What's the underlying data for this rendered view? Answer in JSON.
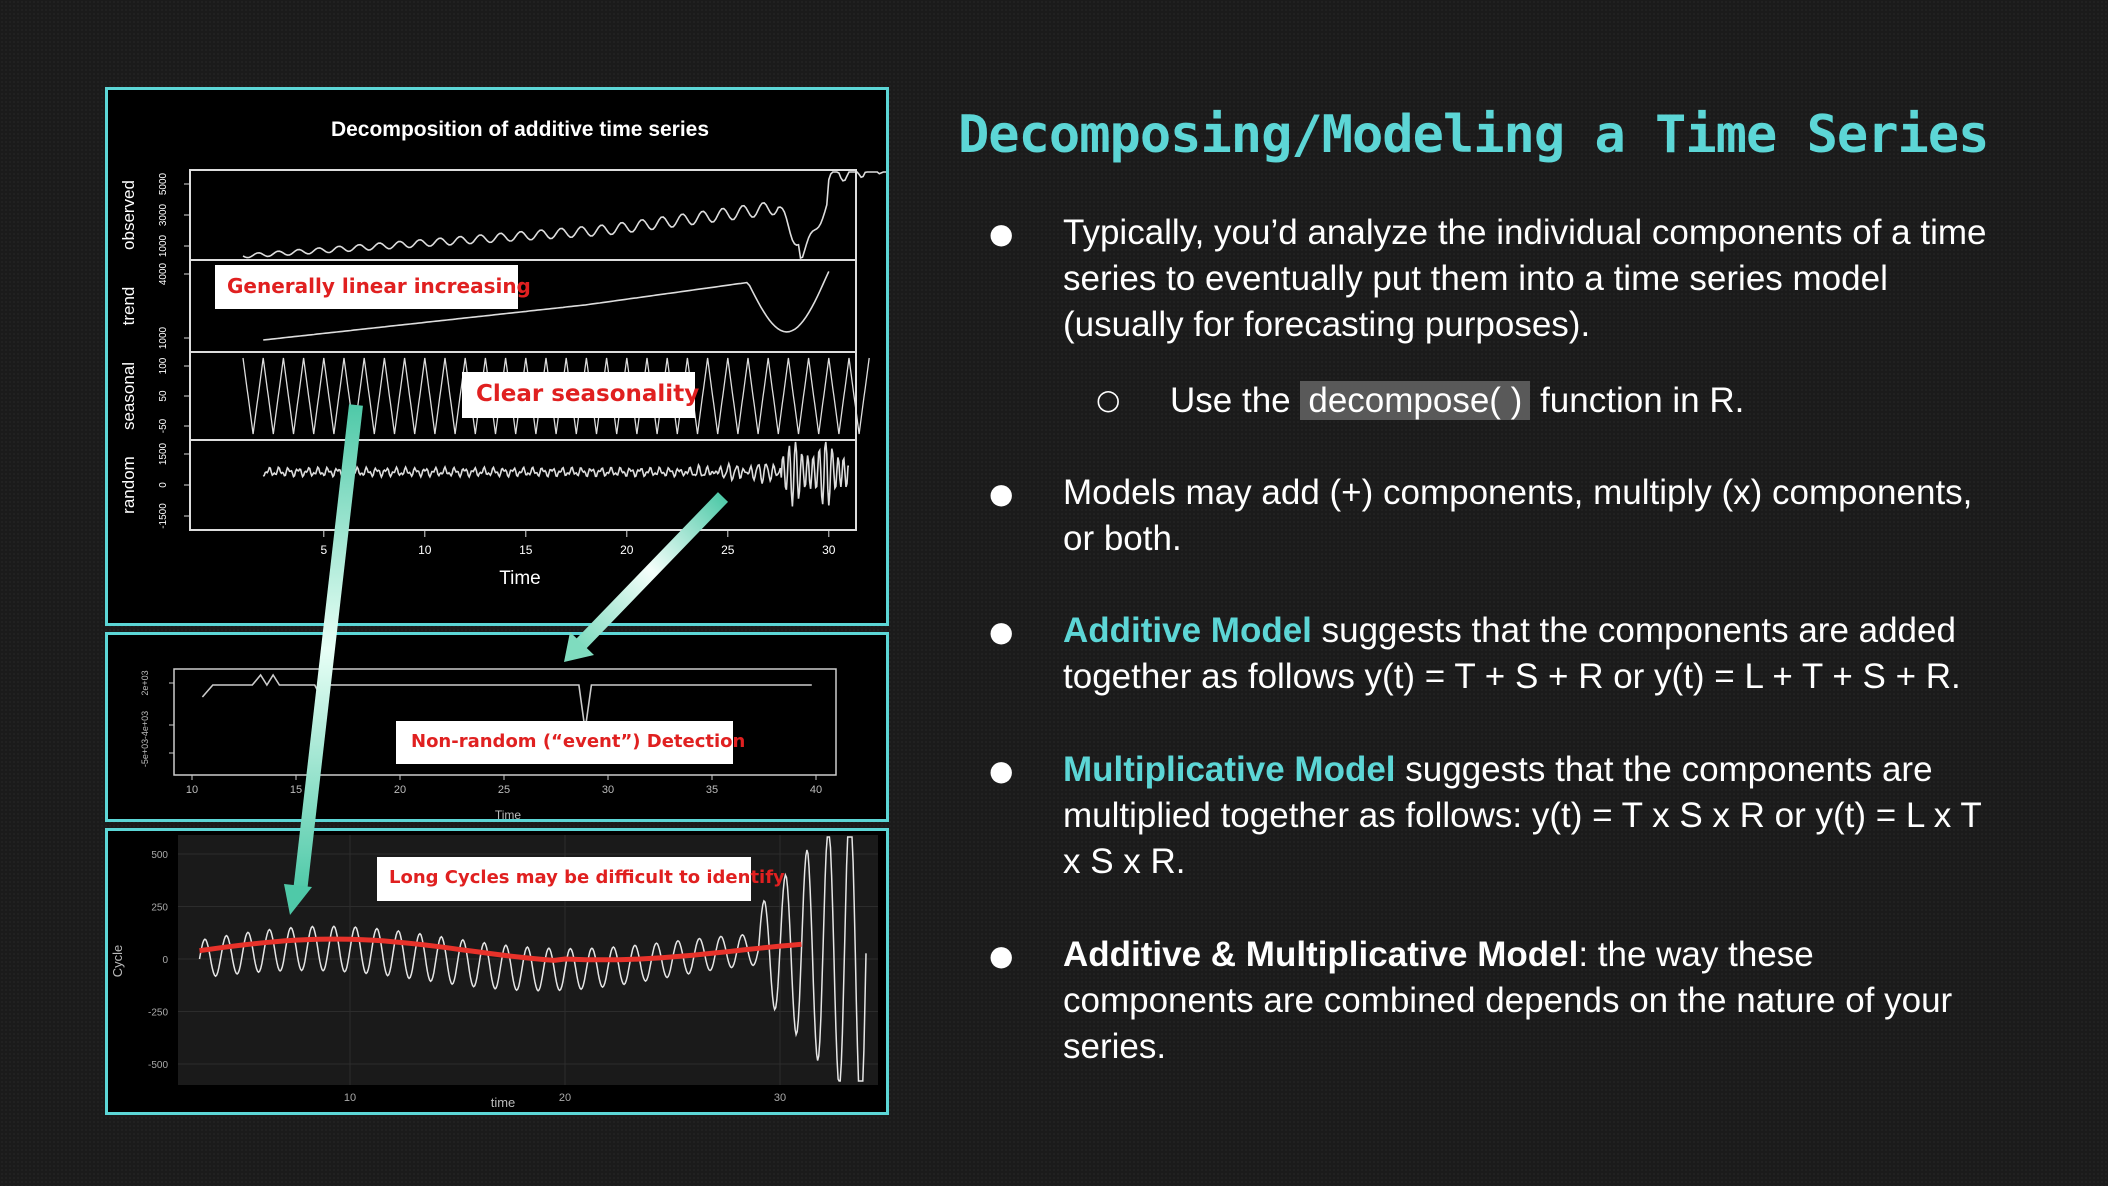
{
  "slide": {
    "title": "Decomposing/Modeling a Time Series",
    "bullets": {
      "b1": "Typically, you’d analyze the individual components of a time series to eventually put them into a time series model (usually for forecasting purposes).",
      "b1_sub_pre": "Use the ",
      "b1_sub_code": "decompose( )",
      "b1_sub_post": " function in R.",
      "b2": "Models may add (+) components, multiply (x) components, or both.",
      "b3_lead": "Additive Model",
      "b3_rest": " suggests that the components are added together as follows y(t) = T + S + R or y(t) = L + T + S + R.",
      "b4_lead": "Multiplicative Model",
      "b4_rest": " suggests that the components are multiplied together as follows: y(t) = T x S x R or y(t) = L x T x S x R.",
      "b5_lead": "Additive & Multiplicative Model",
      "b5_rest": ": the way these components are combined depends on the nature of your series."
    },
    "bullet_glyph": "●",
    "sub_bullet_glyph": "○",
    "colors": {
      "accent": "#5cd6d6",
      "callout_text": "#e02020",
      "arrow": "#6fd9b8",
      "trend_line": "#e8322a"
    }
  },
  "chart_data": [
    {
      "type": "line",
      "title": "Decomposition of additive time series",
      "xlabel": "Time",
      "x_ticks": [
        "5",
        "10",
        "15",
        "20",
        "25",
        "30"
      ],
      "panels": [
        {
          "name": "observed",
          "ticks": [
            "1000",
            "3000",
            "5000"
          ]
        },
        {
          "name": "trend",
          "ticks": [
            "1000",
            "4000"
          ]
        },
        {
          "name": "seasonal",
          "ticks": [
            "-50",
            "50",
            "100"
          ]
        },
        {
          "name": "random",
          "ticks": [
            "-1500",
            "0",
            "1500"
          ]
        }
      ]
    },
    {
      "type": "line",
      "xlabel": "Time",
      "x_ticks": [
        "10",
        "15",
        "20",
        "25",
        "30",
        "35",
        "40"
      ],
      "y_ticks": [
        "-5e+03",
        "-4e+03",
        "2e+03"
      ]
    },
    {
      "type": "line",
      "xlabel": "time",
      "ylabel": "Cycle",
      "x_ticks": [
        "10",
        "20",
        "30"
      ],
      "y_ticks": [
        "500",
        "250",
        "0",
        "-250",
        "-500"
      ]
    }
  ],
  "callouts": {
    "linear": "Generally linear increasing",
    "seasonal": "Clear seasonality",
    "event": "Non-random (“event”) Detection",
    "cycles": "Long Cycles may be difficult to identify"
  }
}
